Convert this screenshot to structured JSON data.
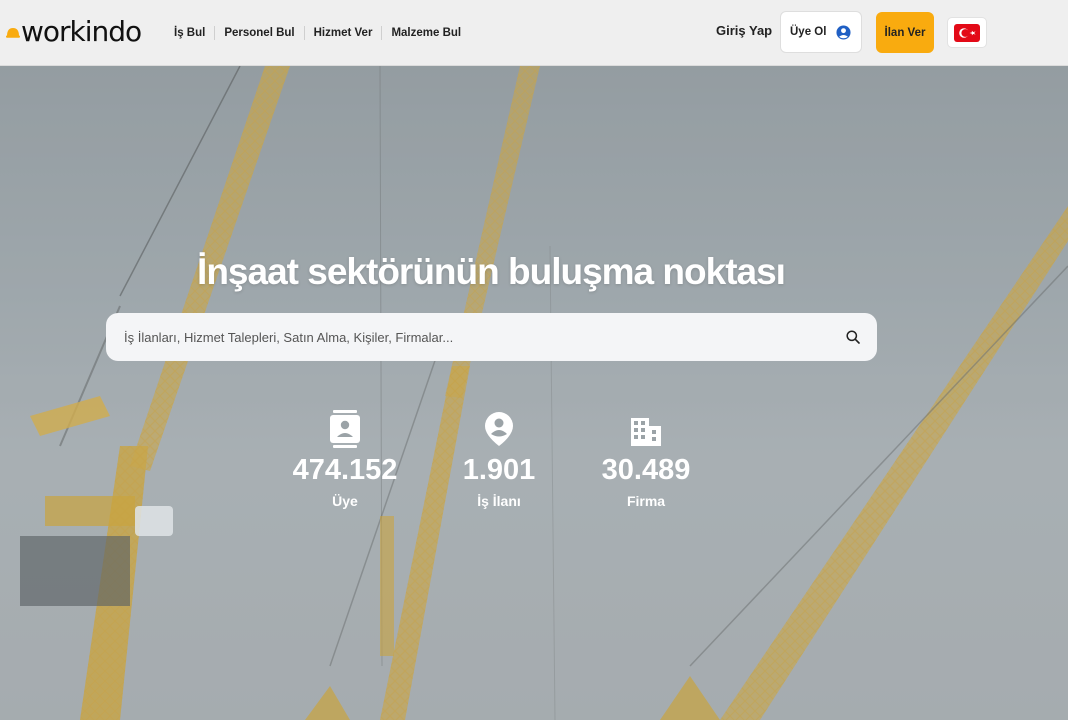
{
  "brand": {
    "logo_text": "workindo"
  },
  "nav": {
    "items": [
      "İş Bul",
      "Personel Bul",
      "Hizmet Ver",
      "Malzeme Bul"
    ]
  },
  "header": {
    "login_label": "Giriş Yap",
    "signup_label": "Üye Ol",
    "post_ad_label": "İlan Ver",
    "language_flag": "turkey-flag-icon"
  },
  "hero": {
    "title": "İnşaat sektörünün buluşma noktası",
    "search_placeholder": "İş İlanları, Hizmet Talepleri, Satın Alma, Kişiler, Firmalar...",
    "stats": [
      {
        "icon": "contact-card-icon",
        "value": "474.152",
        "label": "Üye"
      },
      {
        "icon": "person-pin-icon",
        "value": "1.901",
        "label": "İş İlanı"
      },
      {
        "icon": "building-icon",
        "value": "30.489",
        "label": "Firma"
      }
    ]
  },
  "colors": {
    "accent": "#f9ab0f",
    "header_bg": "#efefef",
    "signup_icon": "#1f5fc4",
    "flag_red": "#e30a17"
  }
}
